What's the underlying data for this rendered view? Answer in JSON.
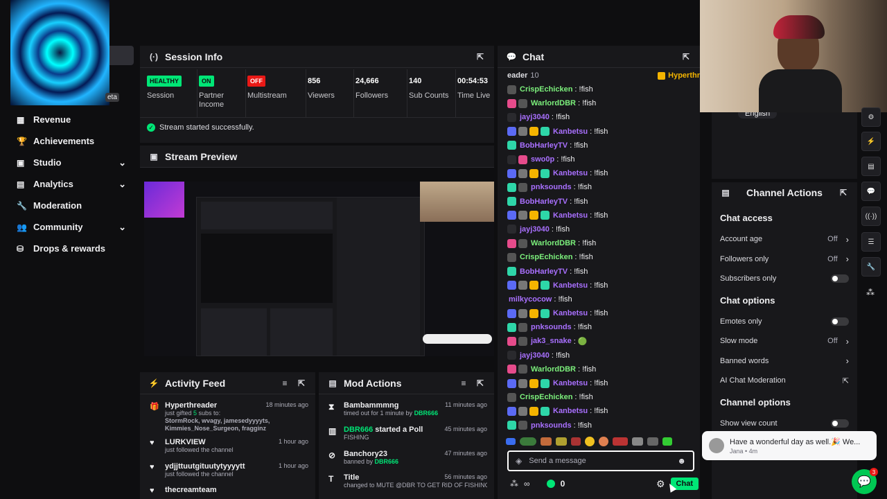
{
  "nav": {
    "items": [
      {
        "label": "Revenue",
        "icon": "revenue-icon",
        "glyph": "▦",
        "chev": ""
      },
      {
        "label": "Achievements",
        "icon": "trophy-icon",
        "glyph": "🏆",
        "chev": ""
      },
      {
        "label": "Studio",
        "icon": "studio-icon",
        "glyph": "▣",
        "chev": "⌄"
      },
      {
        "label": "Analytics",
        "icon": "analytics-icon",
        "glyph": "▤",
        "chev": "⌄"
      },
      {
        "label": "Moderation",
        "icon": "wrench-icon",
        "glyph": "🔧",
        "chev": ""
      },
      {
        "label": "Community",
        "icon": "community-icon",
        "glyph": "👥",
        "chev": "⌄"
      },
      {
        "label": "Drops & rewards",
        "icon": "drops-icon",
        "glyph": "⛁",
        "chev": ""
      }
    ],
    "partial_label": "eta"
  },
  "session": {
    "title": "Session Info",
    "stats": [
      {
        "value": "HEALTHY",
        "label": "Session",
        "badge": true,
        "color": "#00e676",
        "text_color": "#0e0e10"
      },
      {
        "value": "ON",
        "label": "Partner Income",
        "badge": true,
        "color": "#00e676",
        "text_color": "#0e0e10"
      },
      {
        "value": "OFF",
        "label": "Multistream",
        "badge": true,
        "color": "#e91916",
        "text_color": "#ffffff"
      },
      {
        "value": "856",
        "label": "Viewers",
        "badge": false
      },
      {
        "value": "24,666",
        "label": "Followers",
        "badge": false
      },
      {
        "value": "140",
        "label": "Sub Counts",
        "badge": false
      },
      {
        "value": "00:54:53",
        "label": "Time Live",
        "badge": false
      }
    ],
    "status": "Stream started successfully."
  },
  "preview": {
    "title": "Stream Preview"
  },
  "activity": {
    "title": "Activity Feed",
    "items": [
      {
        "name": "Hyperthreader",
        "time": "18 minutes ago",
        "line1": "just gifted ",
        "count": "5",
        "line1b": " subs to:",
        "green": "StormRock, wvagy, jamesedyyyyts, Kimmies_Nose_Surgeon, fragginz"
      },
      {
        "name": "LURKVIEW",
        "time": "1 hour ago",
        "line1": "just followed the channel"
      },
      {
        "name": "ydjjttuutgituutytyyyytt",
        "time": "1 hour ago",
        "line1": "just followed the channel"
      },
      {
        "name": "thecreamteam",
        "time": "",
        "line1": ""
      }
    ]
  },
  "mod": {
    "title": "Mod Actions",
    "items": [
      {
        "name": "Bambammmng",
        "time": "11 minutes ago",
        "action": "timed out for 1 minute by ",
        "by": "DBR666"
      },
      {
        "name": "DBR666",
        "name2": " started a Poll",
        "time": "45 minutes ago",
        "action": "FISHING",
        "by": ""
      },
      {
        "name": "Banchory23",
        "time": "47 minutes ago",
        "action": "banned by ",
        "by": "DBR666"
      },
      {
        "name": "Title",
        "time": "56 minutes ago",
        "action": "changed to MUTE @DBR TO GET RID OF FISHING!URL TRIP COUNTDOWN | DBR LIVE",
        "by": ""
      }
    ]
  },
  "chat": {
    "title": "Chat",
    "leader_partial": "eader",
    "leader_count": "10",
    "leader_name": "Hyperthr",
    "lines": [
      {
        "user": "CrispEchicken",
        "color": "#7cf07c",
        "badges": [
          "#555"
        ],
        "msg": ": !fish"
      },
      {
        "user": "WarlordDBR",
        "color": "#7cf07c",
        "badges": [
          "#e64b8b",
          "#555"
        ],
        "msg": ": !fish"
      },
      {
        "user": "jayj3040",
        "color": "#a970ff",
        "badges": [
          "#2a2a2e"
        ],
        "msg": ": !fish"
      },
      {
        "user": "Kanbetsu",
        "color": "#a970ff",
        "badges": [
          "#5b6af5",
          "#777",
          "#f4b400",
          "#2ed6a8"
        ],
        "msg": ": !fish"
      },
      {
        "user": "BobHarleyTV",
        "color": "#a970ff",
        "badges": [
          "#2ed6a8"
        ],
        "msg": ": !fish"
      },
      {
        "user": "swo0p",
        "color": "#a970ff",
        "badges": [
          "#2a2a2e",
          "#e64b8b"
        ],
        "msg": ": !fish"
      },
      {
        "user": "Kanbetsu",
        "color": "#a970ff",
        "badges": [
          "#5b6af5",
          "#777",
          "#f4b400",
          "#2ed6a8"
        ],
        "msg": ": !fish"
      },
      {
        "user": "pnksounds",
        "color": "#a970ff",
        "badges": [
          "#2ed6a8",
          "#555"
        ],
        "msg": ": !fish"
      },
      {
        "user": "BobHarleyTV",
        "color": "#a970ff",
        "badges": [
          "#2ed6a8"
        ],
        "msg": ": !fish"
      },
      {
        "user": "Kanbetsu",
        "color": "#a970ff",
        "badges": [
          "#5b6af5",
          "#777",
          "#f4b400",
          "#2ed6a8"
        ],
        "msg": ": !fish"
      },
      {
        "user": "jayj3040",
        "color": "#a970ff",
        "badges": [
          "#2a2a2e"
        ],
        "msg": ": !fish"
      },
      {
        "user": "WarlordDBR",
        "color": "#7cf07c",
        "badges": [
          "#e64b8b",
          "#555"
        ],
        "msg": ": !fish"
      },
      {
        "user": "CrispEchicken",
        "color": "#7cf07c",
        "badges": [
          "#555"
        ],
        "msg": ": !fish"
      },
      {
        "user": "BobHarleyTV",
        "color": "#a970ff",
        "badges": [
          "#2ed6a8"
        ],
        "msg": ": !fish"
      },
      {
        "user": "Kanbetsu",
        "color": "#a970ff",
        "badges": [
          "#5b6af5",
          "#777",
          "#f4b400",
          "#2ed6a8"
        ],
        "msg": ": !fish"
      },
      {
        "user": "milkycocow",
        "color": "#a970ff",
        "badges": [],
        "msg": ": !fish"
      },
      {
        "user": "Kanbetsu",
        "color": "#a970ff",
        "badges": [
          "#5b6af5",
          "#777",
          "#f4b400",
          "#2ed6a8"
        ],
        "msg": ": !fish"
      },
      {
        "user": "pnksounds",
        "color": "#a970ff",
        "badges": [
          "#2ed6a8",
          "#555"
        ],
        "msg": ": !fish"
      },
      {
        "user": "jak3_snake",
        "color": "#a970ff",
        "badges": [
          "#e64b8b",
          "#555"
        ],
        "msg": ": 🟢"
      },
      {
        "user": "jayj3040",
        "color": "#a970ff",
        "badges": [
          "#2a2a2e"
        ],
        "msg": ": !fish"
      },
      {
        "user": "WarlordDBR",
        "color": "#7cf07c",
        "badges": [
          "#e64b8b",
          "#555"
        ],
        "msg": ": !fish"
      },
      {
        "user": "Kanbetsu",
        "color": "#a970ff",
        "badges": [
          "#5b6af5",
          "#777",
          "#f4b400",
          "#2ed6a8"
        ],
        "msg": ": !fish"
      },
      {
        "user": "CrispEchicken",
        "color": "#7cf07c",
        "badges": [
          "#555"
        ],
        "msg": ": !fish"
      },
      {
        "user": "Kanbetsu",
        "color": "#a970ff",
        "badges": [
          "#5b6af5",
          "#777",
          "#f4b400",
          "#2ed6a8"
        ],
        "msg": ": !fish"
      },
      {
        "user": "pnksounds",
        "color": "#a970ff",
        "badges": [
          "#2ed6a8",
          "#555"
        ],
        "msg": ": !fish"
      }
    ],
    "placeholder": "Send a message",
    "points": "0",
    "send_label": "Chat"
  },
  "language": "English",
  "channel_actions": {
    "title": "Channel Actions",
    "sections": [
      {
        "title": "Chat access",
        "rows": [
          {
            "label": "Account age",
            "value": "Off",
            "control": "chevron"
          },
          {
            "label": "Followers only",
            "value": "Off",
            "control": "chevron"
          },
          {
            "label": "Subscribers only",
            "value": "",
            "control": "toggle"
          }
        ]
      },
      {
        "title": "Chat options",
        "rows": [
          {
            "label": "Emotes only",
            "value": "",
            "control": "toggle"
          },
          {
            "label": "Slow mode",
            "value": "Off",
            "control": "chevron"
          },
          {
            "label": "Banned words",
            "value": "",
            "control": "chevron"
          },
          {
            "label": "AI Chat Moderation",
            "value": "",
            "control": "external"
          }
        ]
      },
      {
        "title": "Channel options",
        "rows": [
          {
            "label": "Show view count",
            "value": "",
            "control": "toggle"
          }
        ]
      }
    ]
  },
  "notification": {
    "text": "Have a wonderful day as well.🎉 We...",
    "meta": "Jana • 4m"
  },
  "support_badge": "3",
  "colors": {
    "accent": "#00e676",
    "panel": "#18181b",
    "bg": "#0e0e10",
    "danger": "#e91916"
  }
}
